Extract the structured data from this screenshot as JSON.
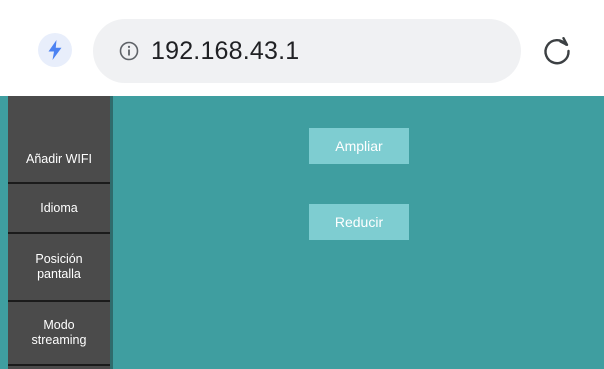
{
  "browser": {
    "url": "192.168.43.1",
    "icons": {
      "left": "bolt-icon",
      "info": "info-icon",
      "reload": "reload-icon"
    },
    "colors": {
      "bolt": "#4c82f2",
      "pill": "#f0f1f3"
    }
  },
  "sidebar": {
    "items": [
      {
        "label": "Añadir WIFI"
      },
      {
        "label": "Idioma"
      },
      {
        "label": "Posición pantalla"
      },
      {
        "label": "Modo streaming"
      }
    ]
  },
  "main": {
    "buttons": {
      "zoom_in": "Ampliar",
      "zoom_out": "Reducir"
    }
  },
  "colors": {
    "background": "#3f9ea0",
    "sidebar": "#4b4b4b",
    "button": "#7ecdd1"
  }
}
